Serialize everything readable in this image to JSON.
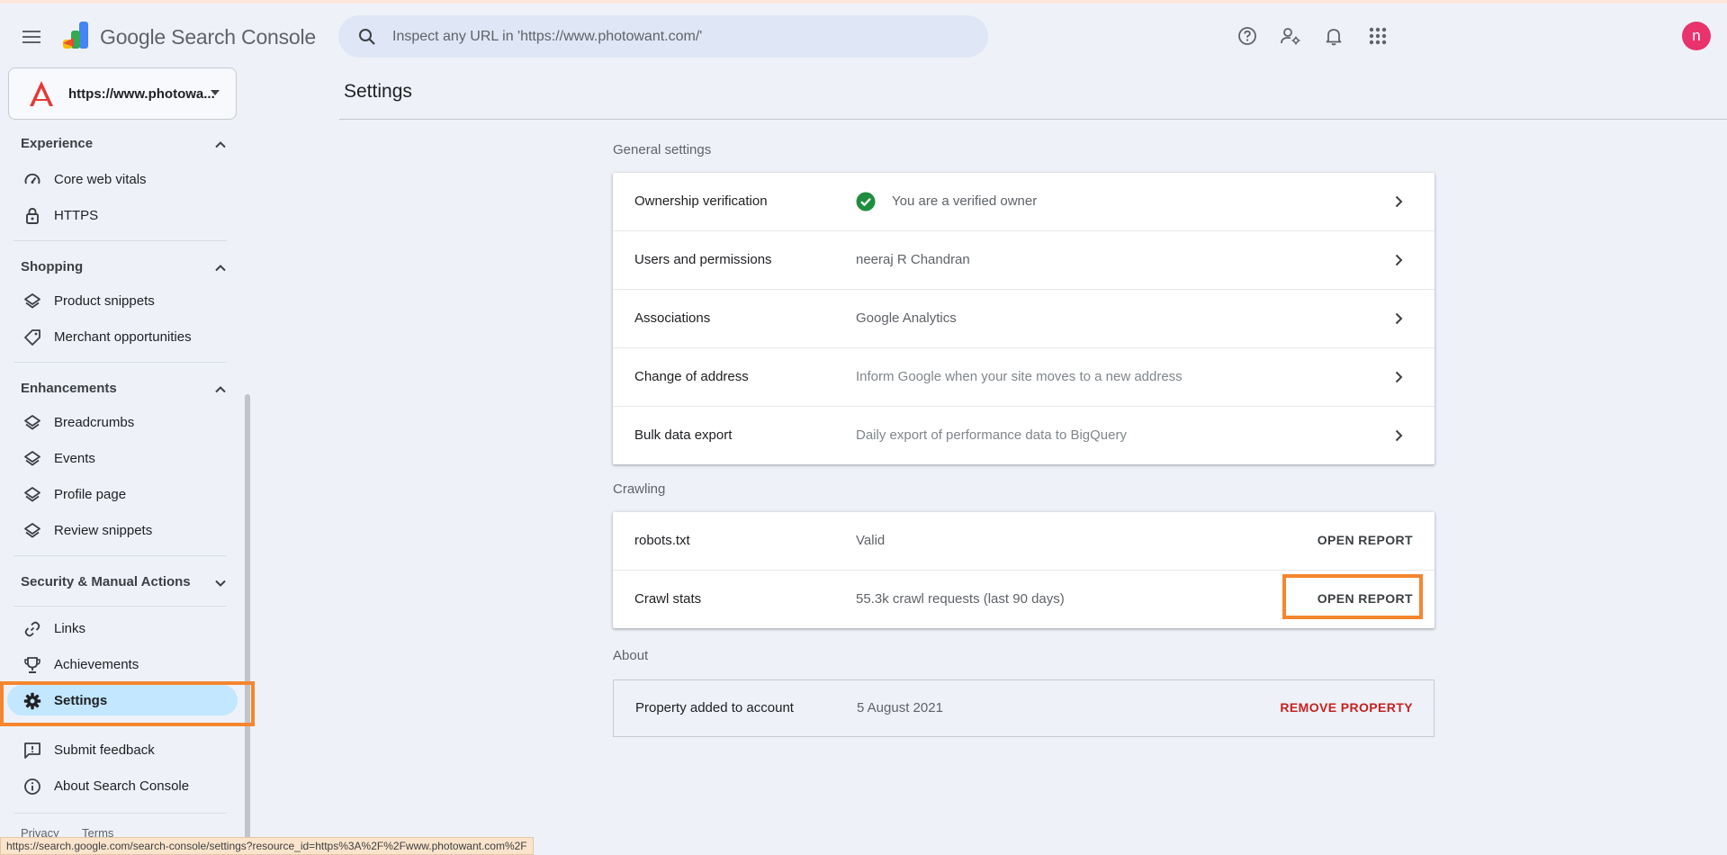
{
  "app": {
    "title_google": "Google",
    "title_product": "Search Console"
  },
  "search": {
    "placeholder": "Inspect any URL in 'https://www.photowant.com/'"
  },
  "header": {
    "avatar_letter": "n",
    "icons": [
      "help-icon",
      "manage-users-icon",
      "notifications-icon",
      "apps-grid-icon"
    ]
  },
  "property": {
    "name": "https://www.photowa..."
  },
  "sidebar": {
    "experience": {
      "heading": "Experience",
      "items": [
        {
          "label": "Core web vitals",
          "icon": "gauge-icon"
        },
        {
          "label": "HTTPS",
          "icon": "lock-icon"
        }
      ]
    },
    "shopping": {
      "heading": "Shopping",
      "items": [
        {
          "label": "Product snippets",
          "icon": "layers-icon"
        },
        {
          "label": "Merchant opportunities",
          "icon": "tag-icon"
        }
      ]
    },
    "enhancements": {
      "heading": "Enhancements",
      "items": [
        {
          "label": "Breadcrumbs",
          "icon": "layers-icon"
        },
        {
          "label": "Events",
          "icon": "layers-icon"
        },
        {
          "label": "Profile page",
          "icon": "layers-icon"
        },
        {
          "label": "Review snippets",
          "icon": "layers-icon"
        }
      ]
    },
    "security": {
      "heading": "Security & Manual Actions"
    },
    "other": {
      "items": [
        {
          "label": "Links",
          "icon": "link-icon"
        },
        {
          "label": "Achievements",
          "icon": "trophy-icon"
        },
        {
          "label": "Settings",
          "icon": "gear-icon"
        }
      ]
    },
    "footer_items": [
      {
        "label": "Submit feedback",
        "icon": "feedback-icon"
      },
      {
        "label": "About Search Console",
        "icon": "info-icon"
      }
    ],
    "footer_links": [
      "Privacy",
      "Terms"
    ]
  },
  "main": {
    "title": "Settings",
    "general": {
      "label": "General settings",
      "rows": [
        {
          "label": "Ownership verification",
          "value": "You are a verified owner"
        },
        {
          "label": "Users and permissions",
          "value": "neeraj R Chandran"
        },
        {
          "label": "Associations",
          "value": "Google Analytics"
        },
        {
          "label": "Change of address",
          "value": "Inform Google when your site moves to a new address"
        },
        {
          "label": "Bulk data export",
          "value": "Daily export of performance data to BigQuery"
        }
      ]
    },
    "crawling": {
      "label": "Crawling",
      "rows": [
        {
          "label": "robots.txt",
          "value": "Valid",
          "action": "OPEN REPORT"
        },
        {
          "label": "Crawl stats",
          "value": "55.3k crawl requests (last 90 days)",
          "action": "OPEN REPORT"
        }
      ]
    },
    "about": {
      "label": "About",
      "row": {
        "label": "Property added to account",
        "value": "5 August 2021",
        "action": "REMOVE PROPERTY"
      }
    }
  },
  "status_bar": {
    "url": "https://search.google.com/search-console/settings?resource_id=https%3A%2F%2Fwww.photowant.com%2F"
  },
  "colors": {
    "highlight": "#f5862e",
    "active_nav": "#c2e7ff",
    "danger": "#c5221f",
    "verified": "#1e8e3e"
  }
}
